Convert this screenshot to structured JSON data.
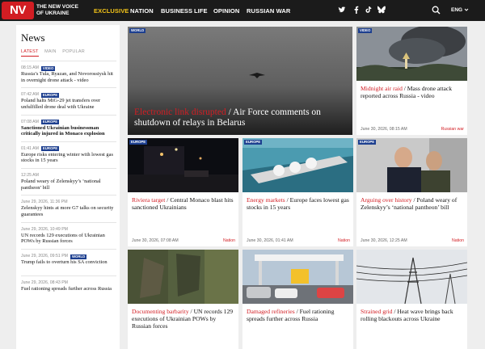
{
  "header": {
    "logo": "NV",
    "brand": "THE NEW VOICE OF UKRAINE",
    "nav": [
      "EXCLUSIVE",
      "NATION",
      "BUSINESS",
      "LIFE",
      "OPINION",
      "RUSSIAN WAR"
    ],
    "social_icons": [
      "twitter-icon",
      "facebook-icon",
      "tiktok-icon",
      "bluesky-icon"
    ],
    "language": "ENG"
  },
  "sidebar": {
    "title": "News",
    "tabs": [
      "LATEST",
      "MAIN",
      "POPULAR"
    ],
    "items": [
      {
        "time": "08:15 AM",
        "tag": "VIDEO",
        "title": "Russia’s Tula, Ryazan, and Novorossiysk hit in overnight drone attack - video",
        "bold": false
      },
      {
        "time": "07:42 AM",
        "tag": "EUROPE",
        "title": "Poland halts MiG-29 jet transfers over unfulfilled drone deal with Ukraine",
        "bold": false
      },
      {
        "time": "07:08 AM",
        "tag": "EUROPE",
        "title": "Sanctioned Ukrainian businessman critically injured in Monaco explosion",
        "bold": true
      },
      {
        "time": "01:41 AM",
        "tag": "EUROPE",
        "title": "Europe risks entering winter with lowest gas stocks in 15 years",
        "bold": false
      },
      {
        "time": "12:25 AM",
        "tag": "",
        "title": "Poland weary of Zelenskyy’s ‘national pantheon’ bill",
        "bold": false
      },
      {
        "time": "June 29, 2026, 11:36 PM",
        "tag": "",
        "title": "Zelenskyy hints at more G7 talks on security guarantees",
        "bold": false
      },
      {
        "time": "June 29, 2026, 10:49 PM",
        "tag": "",
        "title": "UN records 129 executions of Ukrainian POWs by Russian forces",
        "bold": false
      },
      {
        "time": "June 29, 2026, 09:51 PM",
        "tag": "WORLD",
        "title": "Trump fails to overturn his SA conviction",
        "bold": false
      },
      {
        "time": "June 29, 2026, 08:43 PM",
        "tag": "",
        "title": "Fuel rationing spreads further across Russia",
        "bold": false
      }
    ]
  },
  "hero": {
    "badge": "WORLD",
    "title_red": "Electronic link disrupted",
    "title_rest": " / Air Force comments on shutdown of relays in Belarus"
  },
  "cards": [
    {
      "badge": "VIDEO",
      "red": "Midnight air raid",
      "rest": " / Mass drone attack reported across Russia - video",
      "date": "June 30, 2026, 08:15 AM",
      "section": "Russian war"
    },
    {
      "badge": "EUROPE",
      "red": "Riviera target",
      "rest": " / Central Monaco blast hits sanctioned Ukrainians",
      "date": "June 30, 2026, 07:08 AM",
      "section": "Nation"
    },
    {
      "badge": "EUROPE",
      "red": "Energy markets",
      "rest": " / Europe faces lowest gas stocks in 15 years",
      "date": "June 30, 2026, 01:41 AM",
      "section": "Nation"
    },
    {
      "badge": "EUROPE",
      "red": "Arguing over history",
      "rest": " / Poland weary of Zelenskyy’s ‘national pantheon’ bill",
      "date": "June 30, 2026, 12:25 AM",
      "section": "Nation"
    },
    {
      "badge": "",
      "red": "Documenting barbarity",
      "rest": " / UN records 129 executions of Ukrainian POWs by Russian forces",
      "date": "",
      "section": ""
    },
    {
      "badge": "",
      "red": "Damaged refineries",
      "rest": " / Fuel rationing spreads further across Russia",
      "date": "",
      "section": ""
    },
    {
      "badge": "",
      "red": "Strained grid",
      "rest": " / Heat wave brings back rolling blackouts across Ukraine",
      "date": "",
      "section": ""
    }
  ],
  "colors": {
    "accent": "#d21d23",
    "header_bg": "#1b1b1b",
    "tag_bg": "#1d3f8f",
    "exclusive": "#f5c518"
  }
}
